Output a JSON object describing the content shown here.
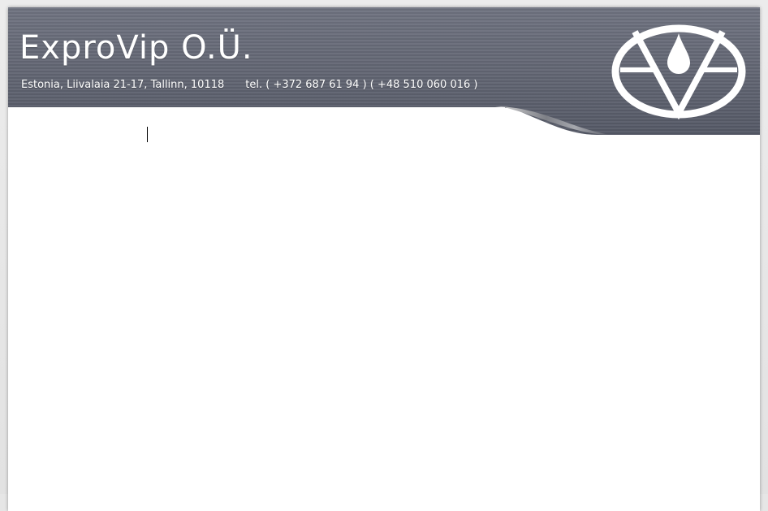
{
  "letterhead": {
    "company_name": "ExproVip O.Ü.",
    "address": "Estonia, Liivalaia 21-17, Tallinn, 10118",
    "phone": "tel. ( +372 687 61 94 )  ( +48 510 060 016 )",
    "logo_icon": "ev-drop-emblem-icon"
  },
  "colors": {
    "band_dark": "#5d6170",
    "band_light": "#8a8e9a",
    "text": "#ffffff",
    "page": "#ffffff",
    "workspace": "#e6e6e6"
  },
  "document": {
    "body_text": ""
  }
}
